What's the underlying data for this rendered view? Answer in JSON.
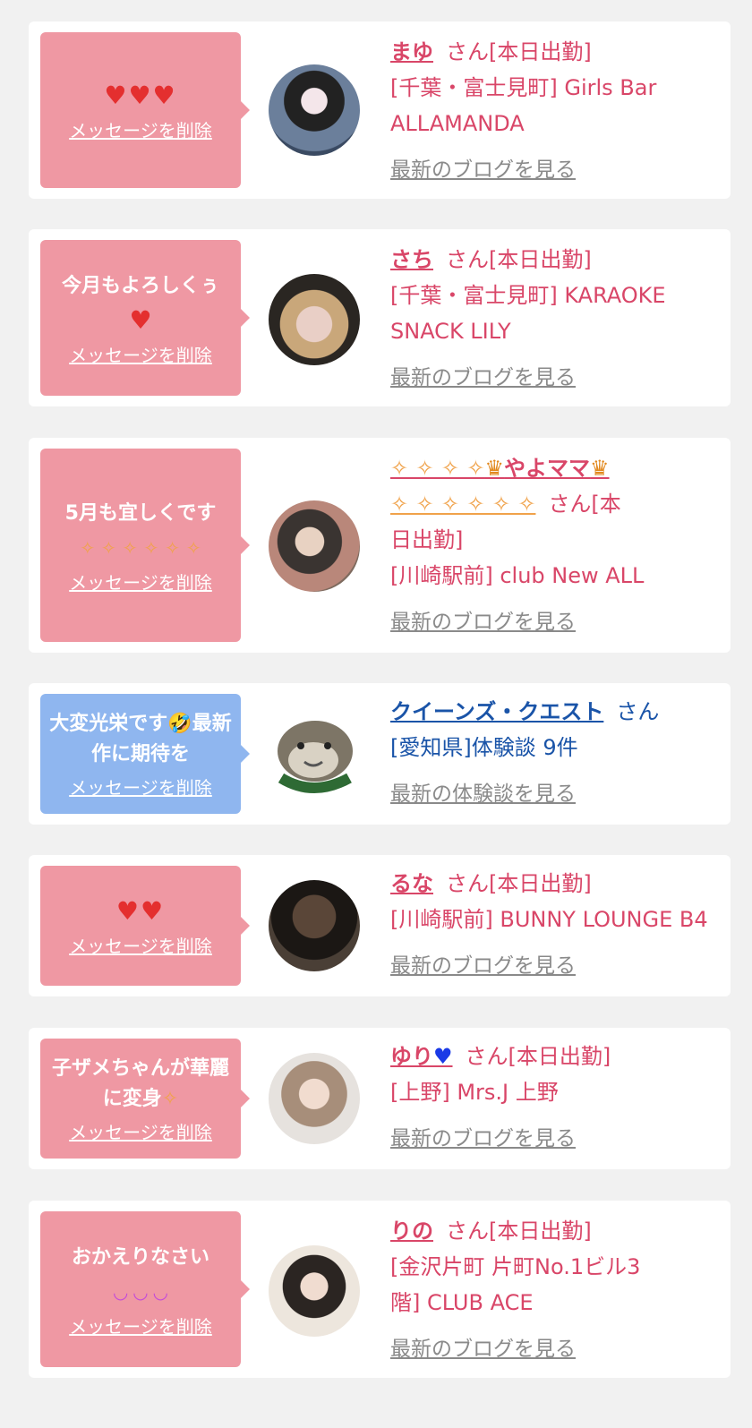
{
  "delete_label": "メッセージを削除",
  "san_suffix": "さん",
  "cards": [
    {
      "message_glyphs": "♥♥♥",
      "name": "まゆ",
      "status": "さん[本日出勤]",
      "location": "[千葉・富士見町] Girls Bar",
      "location2": "ALLAMANDA",
      "link": "最新のブログを見る"
    },
    {
      "message": "今月もよろしくぅ",
      "message_glyphs": "♥",
      "name": "さち",
      "status": "さん[本日出勤]",
      "location": "[千葉・富士見町] KARAOKE",
      "location2": "SNACK LILY",
      "link": "最新のブログを見る"
    },
    {
      "message": "5月も宜しくです",
      "message_glyphs": "✧ ✧ ✧ ✧ ✧ ✧",
      "name_pre": "✧ ✧ ✧ ✧",
      "name_crown": "♛",
      "name": "やよママ",
      "name_post": "✧ ✧ ✧ ✧ ✧ ✧",
      "status": "さん[本",
      "status2": "日出勤]",
      "location": "[川崎駅前] club New ALL",
      "link": "最新のブログを見る"
    },
    {
      "message": "大変光栄です🤣最新作に期待を",
      "name": "クイーンズ・クエスト",
      "status": "さん",
      "location": "[愛知県]体験談 9件",
      "link": "最新の体験談を見る"
    },
    {
      "message_glyphs": "♥♥",
      "name": "るな",
      "status": "さん[本日出勤]",
      "location": "[川崎駅前] BUNNY LOUNGE B4",
      "link": "最新のブログを見る"
    },
    {
      "message": "子ザメちゃんが華麗に変身",
      "message_glyphs": "✧",
      "name": "ゆり",
      "name_glyph": "♥",
      "status": "さん[本日出勤]",
      "location": "[上野] Mrs.J 上野",
      "link": "最新のブログを見る"
    },
    {
      "message": "おかえりなさい",
      "message_glyphs": "◡ ◡ ◡",
      "name": "りの",
      "status": "さん[本日出勤]",
      "location": "[金沢片町 片町No.1ビル3",
      "location2": "階] CLUB ACE",
      "link": "最新のブログを見る"
    }
  ],
  "colors": {
    "bubble_pink": "#ef98a3",
    "bubble_blue": "#8fb6ef",
    "name_pink": "#d94668",
    "name_blue": "#1a54a8",
    "link_gray": "#8a8a8a"
  }
}
